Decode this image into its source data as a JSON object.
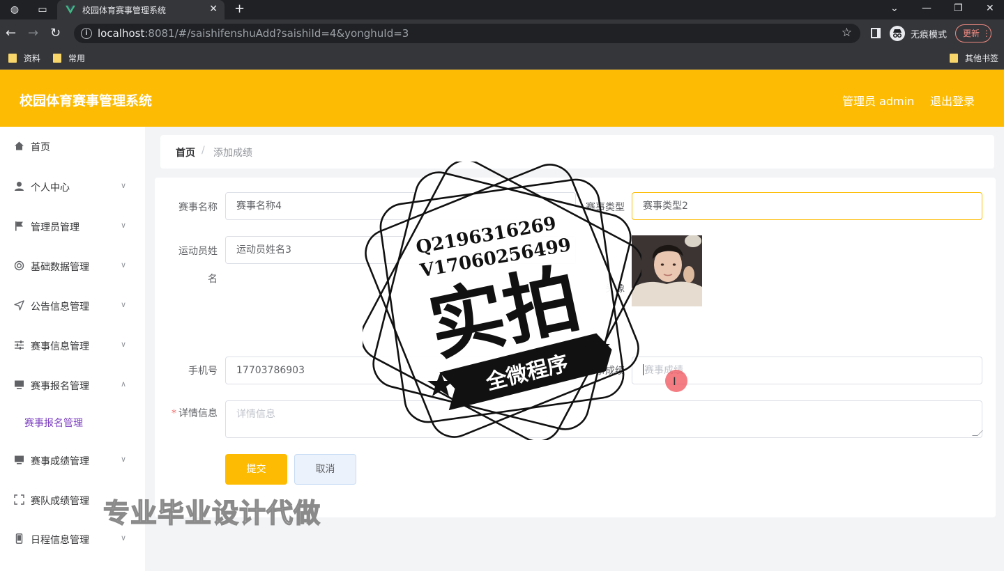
{
  "browser": {
    "tab_title": "校园体育赛事管理系统",
    "url_host": "localhost",
    "url_rest": ":8081/#/saishifenshuAdd?saishiId=4&yonghuId=3",
    "incognito_label": "无痕模式",
    "update_label": "更新",
    "bookmarks": [
      "资料",
      "常用"
    ],
    "other_bookmarks": "其他书签"
  },
  "header": {
    "app_title": "校园体育赛事管理系统",
    "user_label": "管理员 admin",
    "logout_label": "退出登录",
    "accent_color": "#fdbc03"
  },
  "sidebar": {
    "items": [
      {
        "label": "首页",
        "icon": "home-icon"
      },
      {
        "label": "个人中心",
        "icon": "user-icon"
      },
      {
        "label": "管理员管理",
        "icon": "flag-icon"
      },
      {
        "label": "基础数据管理",
        "icon": "settings-icon"
      },
      {
        "label": "公告信息管理",
        "icon": "send-icon"
      },
      {
        "label": "赛事信息管理",
        "icon": "sliders-icon"
      },
      {
        "label": "赛事报名管理",
        "icon": "monitor-icon"
      },
      {
        "label": "赛事成绩管理",
        "icon": "monitor-icon"
      },
      {
        "label": "赛队成绩管理",
        "icon": "fullscreen-icon"
      },
      {
        "label": "日程信息管理",
        "icon": "mobile-icon"
      }
    ],
    "active_sub_item": "赛事报名管理"
  },
  "breadcrumb": {
    "home": "首页",
    "separator": "/",
    "current": "添加成绩"
  },
  "form": {
    "match_name": {
      "label": "赛事名称",
      "value": "赛事名称4"
    },
    "match_type": {
      "label": "赛事类型",
      "value": "赛事类型2"
    },
    "athlete_name": {
      "label_line1": "运动员姓",
      "label_line2": "名",
      "value": "运动员姓名3"
    },
    "avatar": {
      "label": "头像"
    },
    "phone": {
      "label": "手机号",
      "value": "17703786903"
    },
    "score": {
      "required": "*",
      "label": "赛事成绩",
      "placeholder": "赛事成绩"
    },
    "detail": {
      "required": "*",
      "label": "详情信息",
      "placeholder": "详情信息"
    },
    "submit_label": "提交",
    "cancel_label": "取消"
  },
  "watermark": {
    "qq_line": "Q2196316269",
    "vx_line": "V17060256499",
    "big_text": "实拍",
    "ribbon_text": "全微程序",
    "caption": "专业毕业设计代做"
  }
}
